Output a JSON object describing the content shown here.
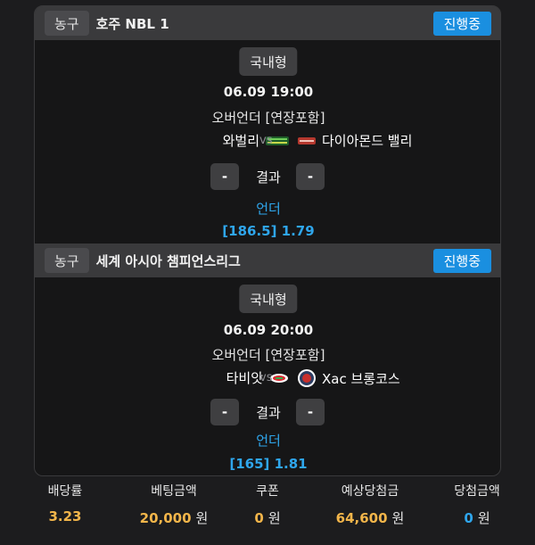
{
  "bets": [
    {
      "sport": "농구",
      "league": "호주 NBL 1",
      "status": "진행중",
      "type": "국내형",
      "datetime": "06.09 19:00",
      "market": "오버언더 [연장포함]",
      "home_team": "와벌리",
      "away_team": "다이아몬드 밸리",
      "vs": "vs",
      "left_btn": "-",
      "result_label": "결과",
      "right_btn": "-",
      "pick": "언더",
      "odds_text": "[186.5] 1.79",
      "home_logo_color": "#2e8b3a",
      "away_logo_color": "#b5382e"
    },
    {
      "sport": "농구",
      "league": "세계 아시아 챔피언스리그",
      "status": "진행중",
      "type": "국내형",
      "datetime": "06.09 20:00",
      "market": "오버언더 [연장포함]",
      "home_team": "타비앗",
      "away_team": "Xac 브롱코스",
      "vs": "vs",
      "left_btn": "-",
      "result_label": "결과",
      "right_btn": "-",
      "pick": "언더",
      "odds_text": "[165] 1.81",
      "home_logo_color": "#d8282f",
      "away_logo_color": "#c9302c"
    }
  ],
  "summary": {
    "odds_label": "배당률",
    "odds_value": "3.23",
    "stake_label": "베팅금액",
    "stake_value": "20,000",
    "stake_unit": "원",
    "coupon_label": "쿠폰",
    "coupon_value": "0",
    "coupon_unit": "원",
    "expected_label": "예상당첨금",
    "expected_value": "64,600",
    "expected_unit": "원",
    "win_label": "당첨금액",
    "win_value": "0",
    "win_unit": "원"
  },
  "colors": {
    "accent_blue": "#1a8fe0",
    "link_blue": "#2fa6ec",
    "gold": "#f2b54a"
  }
}
